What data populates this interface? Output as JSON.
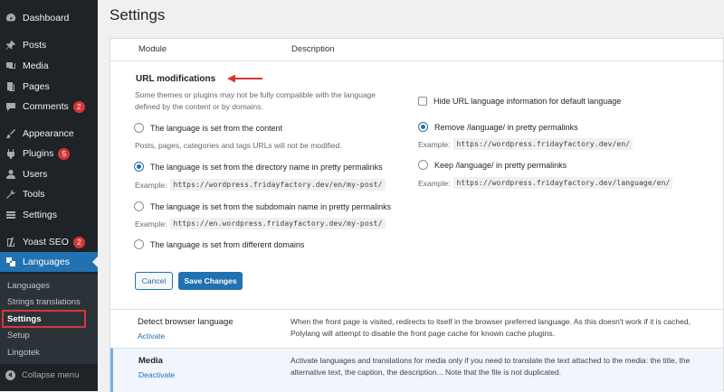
{
  "sidebar": {
    "items": [
      {
        "label": "Dashboard",
        "icon": "dashboard-icon"
      },
      {
        "label": "Posts",
        "icon": "pin-icon"
      },
      {
        "label": "Media",
        "icon": "media-icon"
      },
      {
        "label": "Pages",
        "icon": "page-icon"
      },
      {
        "label": "Comments",
        "icon": "comment-icon",
        "badge": "2"
      },
      {
        "label": "Appearance",
        "icon": "brush-icon"
      },
      {
        "label": "Plugins",
        "icon": "plugin-icon",
        "badge": "5"
      },
      {
        "label": "Users",
        "icon": "user-icon"
      },
      {
        "label": "Tools",
        "icon": "wrench-icon"
      },
      {
        "label": "Settings",
        "icon": "settings-icon"
      },
      {
        "label": "Yoast SEO",
        "icon": "yoast-icon",
        "badge": "2"
      },
      {
        "label": "Languages",
        "icon": "translation-icon"
      }
    ],
    "submenu": [
      "Languages",
      "Strings translations",
      "Settings",
      "Setup",
      "Lingotek"
    ],
    "collapse_label": "Collapse menu"
  },
  "page_title": "Settings",
  "table_header": {
    "module": "Module",
    "description": "Description"
  },
  "url_mod": {
    "title": "URL modifications",
    "warning_line1": "Some themes or plugins may not be fully compatible with the language",
    "warning_line2": "defined by the content or by domains.",
    "opt_content": "The language is set from the content",
    "content_note": "Posts, pages, categories and tags URLs will not be modified.",
    "opt_directory": "The language is set from the directory name in pretty permalinks",
    "example_label": "Example:",
    "example_directory": "https://wordpress.fridayfactory.dev/en/my-post/",
    "opt_subdomain": "The language is set from the subdomain name in pretty permalinks",
    "example_subdomain": "https://en.wordpress.fridayfactory.dev/my-post/",
    "opt_domains": "The language is set from different domains",
    "hide_default": "Hide URL language information for default language",
    "opt_remove": "Remove /language/ in pretty permalinks",
    "example_remove": "https://wordpress.fridayfactory.dev/en/",
    "opt_keep": "Keep /language/ in pretty permalinks",
    "example_keep": "https://wordpress.fridayfactory.dev/language/en/",
    "selected_mode": "directory",
    "selected_language_slug": "remove"
  },
  "buttons": {
    "cancel": "Cancel",
    "save": "Save Changes"
  },
  "modules": [
    {
      "name": "Detect browser language",
      "action": "Activate",
      "description": "When the front page is visited, redirects to itself in the browser preferred language. As this doesn't work if it is cached, Polylang will attempt to disable the front page cache for known cache plugins."
    },
    {
      "name": "Media",
      "action": "Deactivate",
      "description": "Activate languages and translations for media only if you need to translate the text attached to the media: the title, the alternative text, the caption, the description... Note that the file is not duplicated."
    }
  ],
  "colors": {
    "accent": "#2271b1",
    "sidebar_bg": "#1d2327",
    "annotation_red": "#d63638"
  }
}
